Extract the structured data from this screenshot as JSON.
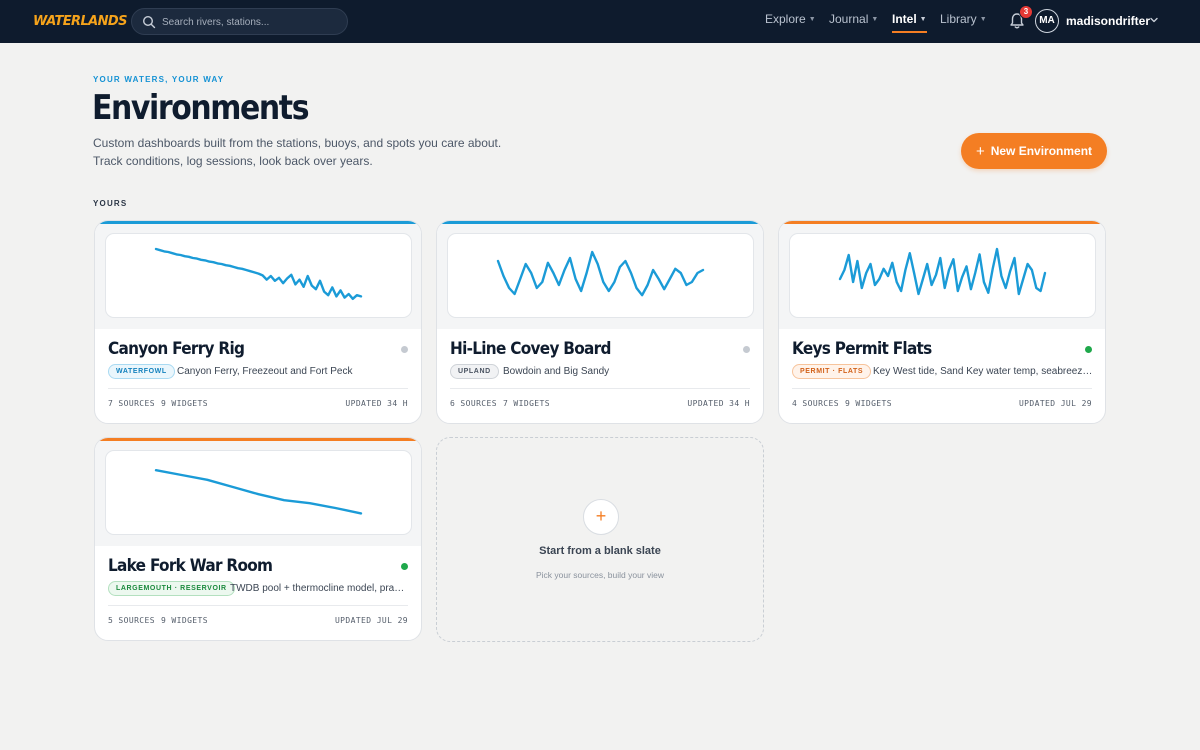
{
  "brand": {
    "part1": "WATER",
    "part2": "LANDS"
  },
  "search": {
    "placeholder": "Search rivers, stations..."
  },
  "nav": {
    "items": [
      {
        "label": "Explore",
        "active": false
      },
      {
        "label": "Journal",
        "active": false
      },
      {
        "label": "Intel",
        "active": true
      },
      {
        "label": "Library",
        "active": false
      }
    ]
  },
  "notifications": {
    "count": "3"
  },
  "user": {
    "initials": "MA",
    "username": "madisondrifter"
  },
  "header": {
    "eyebrow": "YOUR WATERS, YOUR WAY",
    "title": "Environments",
    "subtitle": "Custom dashboards built from the stations, buoys, and spots you care about. Track conditions, log sessions, look back over years.",
    "new_button": "New Environment"
  },
  "section_label": "YOURS",
  "colors": {
    "accent": "#f47e23",
    "blue": "#1b9bd7",
    "status_online": "#1fa84b",
    "status_idle": "#c5cad1"
  },
  "cards": [
    {
      "name": "Canyon Ferry Rig",
      "tag": "WATERFOWL",
      "tag_style": "blue",
      "description": "Canyon Ferry, Freezeout and Fort Peck",
      "sources": "7 SOURCES",
      "widgets": "9 WIDGETS",
      "updated": "UPDATED 34 H",
      "status": "idle",
      "accent": "blue",
      "sparkline": [
        0.95,
        0.93,
        0.91,
        0.9,
        0.88,
        0.86,
        0.85,
        0.83,
        0.82,
        0.8,
        0.79,
        0.77,
        0.76,
        0.74,
        0.73,
        0.71,
        0.7,
        0.68,
        0.67,
        0.65,
        0.63,
        0.62,
        0.6,
        0.58,
        0.56,
        0.54,
        0.51,
        0.44,
        0.5,
        0.42,
        0.47,
        0.38,
        0.46,
        0.52,
        0.36,
        0.44,
        0.32,
        0.5,
        0.34,
        0.28,
        0.42,
        0.24,
        0.18,
        0.31,
        0.16,
        0.26,
        0.14,
        0.2,
        0.12,
        0.18,
        0.16
      ]
    },
    {
      "name": "Hi-Line Covey Board",
      "tag": "UPLAND",
      "tag_style": "gray",
      "description": "Bowdoin and Big Sandy",
      "sources": "6 SOURCES",
      "widgets": "7 WIDGETS",
      "updated": "UPDATED 34 H",
      "status": "idle",
      "accent": "blue",
      "sparkline": [
        0.75,
        0.5,
        0.3,
        0.2,
        0.45,
        0.7,
        0.55,
        0.3,
        0.4,
        0.72,
        0.55,
        0.35,
        0.6,
        0.8,
        0.45,
        0.25,
        0.55,
        0.9,
        0.7,
        0.4,
        0.25,
        0.4,
        0.65,
        0.75,
        0.55,
        0.3,
        0.18,
        0.35,
        0.6,
        0.45,
        0.28,
        0.45,
        0.62,
        0.55,
        0.35,
        0.4,
        0.55,
        0.6
      ]
    },
    {
      "name": "Keys Permit Flats",
      "tag": "PERMIT · FLATS",
      "tag_style": "orange",
      "description": "Key West tide, Sand Key water temp, seabreeze and wind",
      "sources": "4 SOURCES",
      "widgets": "9 WIDGETS",
      "updated": "UPDATED JUL 29",
      "status": "online",
      "accent": "orange",
      "sparkline": [
        0.45,
        0.6,
        0.85,
        0.4,
        0.75,
        0.3,
        0.55,
        0.7,
        0.35,
        0.45,
        0.62,
        0.5,
        0.72,
        0.4,
        0.25,
        0.6,
        0.88,
        0.55,
        0.2,
        0.45,
        0.7,
        0.35,
        0.52,
        0.8,
        0.3,
        0.6,
        0.78,
        0.25,
        0.48,
        0.66,
        0.28,
        0.55,
        0.86,
        0.4,
        0.22,
        0.62,
        0.95,
        0.5,
        0.3,
        0.58,
        0.8,
        0.2,
        0.45,
        0.7,
        0.6,
        0.3,
        0.25,
        0.55
      ]
    },
    {
      "name": "Lake Fork War Room",
      "tag": "LARGEMOUTH · RESERVOIR",
      "tag_style": "green",
      "description": "TWDB pool + thermocline model, practice lineup",
      "sources": "5 SOURCES",
      "widgets": "9 WIDGETS",
      "updated": "UPDATED JUL 29",
      "status": "online",
      "accent": "orange",
      "sparkline": [
        0.88,
        0.8,
        0.72,
        0.6,
        0.48,
        0.38,
        0.33,
        0.25,
        0.16
      ]
    }
  ],
  "blank": {
    "title": "Start from a blank slate",
    "subtitle": "Pick your sources, build your view"
  }
}
